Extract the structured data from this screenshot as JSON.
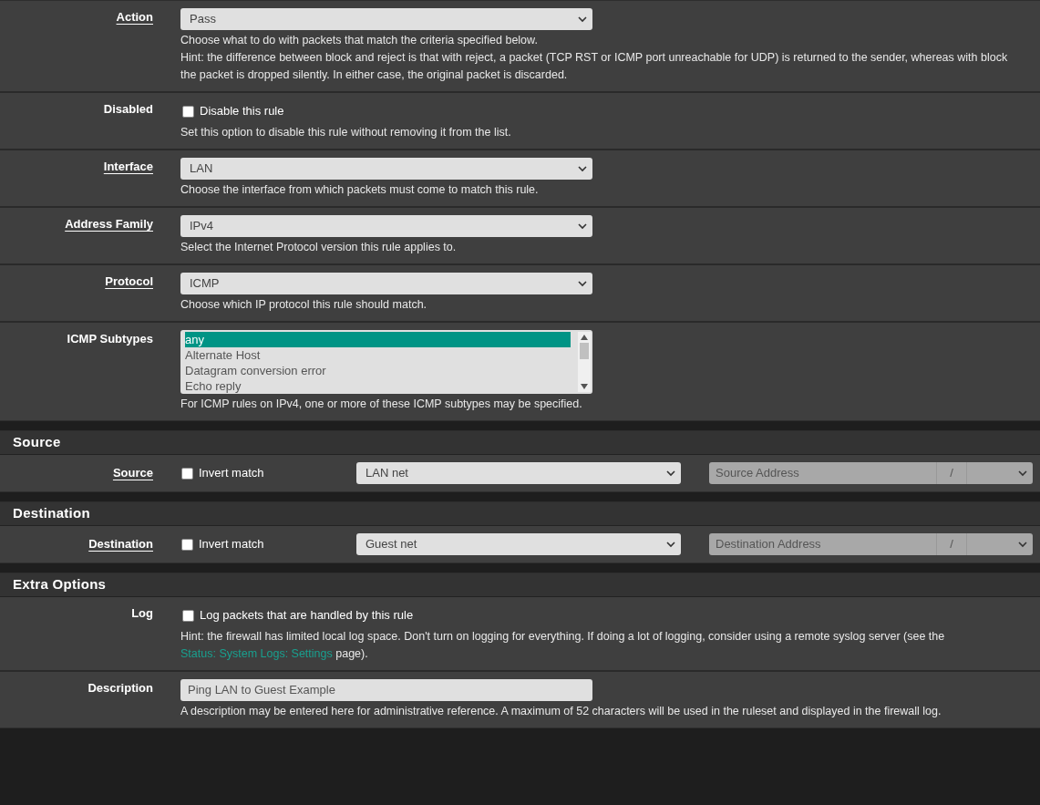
{
  "sections": [
    {
      "rows": [
        {
          "kind": "select",
          "label": "Action",
          "linked": true,
          "value": "Pass",
          "help": [
            {
              "kind": "text",
              "text": "Choose what to do with packets that match the criteria specified below."
            },
            {
              "kind": "break"
            },
            {
              "kind": "text",
              "text": "Hint: the difference between block and reject is that with reject, a packet (TCP RST or ICMP port unreachable for UDP) is returned to the sender, whereas with block the packet is dropped silently. In either case, the original packet is discarded."
            }
          ]
        },
        {
          "kind": "checkbox",
          "label": "Disabled",
          "linked": false,
          "checked": false,
          "text": "Disable this rule",
          "help": [
            {
              "kind": "text",
              "text": "Set this option to disable this rule without removing it from the list."
            }
          ]
        },
        {
          "kind": "select",
          "label": "Interface",
          "linked": true,
          "value": "LAN",
          "help": [
            {
              "kind": "text",
              "text": "Choose the interface from which packets must come to match this rule."
            }
          ]
        },
        {
          "kind": "select",
          "label": "Address Family",
          "linked": true,
          "value": "IPv4",
          "help": [
            {
              "kind": "text",
              "text": "Select the Internet Protocol version this rule applies to."
            }
          ]
        },
        {
          "kind": "select",
          "label": "Protocol",
          "linked": true,
          "value": "ICMP",
          "help": [
            {
              "kind": "text",
              "text": "Choose which IP protocol this rule should match."
            }
          ]
        },
        {
          "kind": "listbox",
          "label": "ICMP Subtypes",
          "linked": false,
          "options": [
            {
              "text": "any",
              "selected": true
            },
            {
              "text": "Alternate Host",
              "selected": false
            },
            {
              "text": "Datagram conversion error",
              "selected": false
            },
            {
              "text": "Echo reply",
              "selected": false
            }
          ],
          "help": [
            {
              "kind": "text",
              "text": "For ICMP rules on IPv4, one or more of these ICMP subtypes may be specified."
            }
          ]
        }
      ]
    },
    {
      "title": "Source",
      "rows": [
        {
          "kind": "address",
          "label": "Source",
          "linked": true,
          "checked": false,
          "text": "Invert match",
          "value": "LAN net",
          "placeholder": "Source Address",
          "separator": "/"
        }
      ]
    },
    {
      "title": "Destination",
      "rows": [
        {
          "kind": "address",
          "label": "Destination",
          "linked": true,
          "checked": false,
          "text": "Invert match",
          "value": "Guest net",
          "placeholder": "Destination Address",
          "separator": "/"
        }
      ]
    },
    {
      "title": "Extra Options",
      "rows": [
        {
          "kind": "checkbox",
          "label": "Log",
          "linked": false,
          "checked": false,
          "text": "Log packets that are handled by this rule",
          "help": [
            {
              "kind": "text",
              "text": "Hint: the firewall has limited local log space. Don't turn on logging for everything. If doing a lot of logging, consider using a remote syslog server (see the "
            },
            {
              "kind": "link",
              "text": "Status: System Logs: Settings"
            },
            {
              "kind": "text",
              "text": " page)."
            }
          ]
        },
        {
          "kind": "text",
          "label": "Description",
          "linked": false,
          "value": "Ping LAN to Guest Example",
          "help": [
            {
              "kind": "text",
              "text": "A description may be entered here for administrative reference. A maximum of 52 characters will be used in the ruleset and displayed in the firewall log."
            }
          ]
        }
      ]
    }
  ]
}
